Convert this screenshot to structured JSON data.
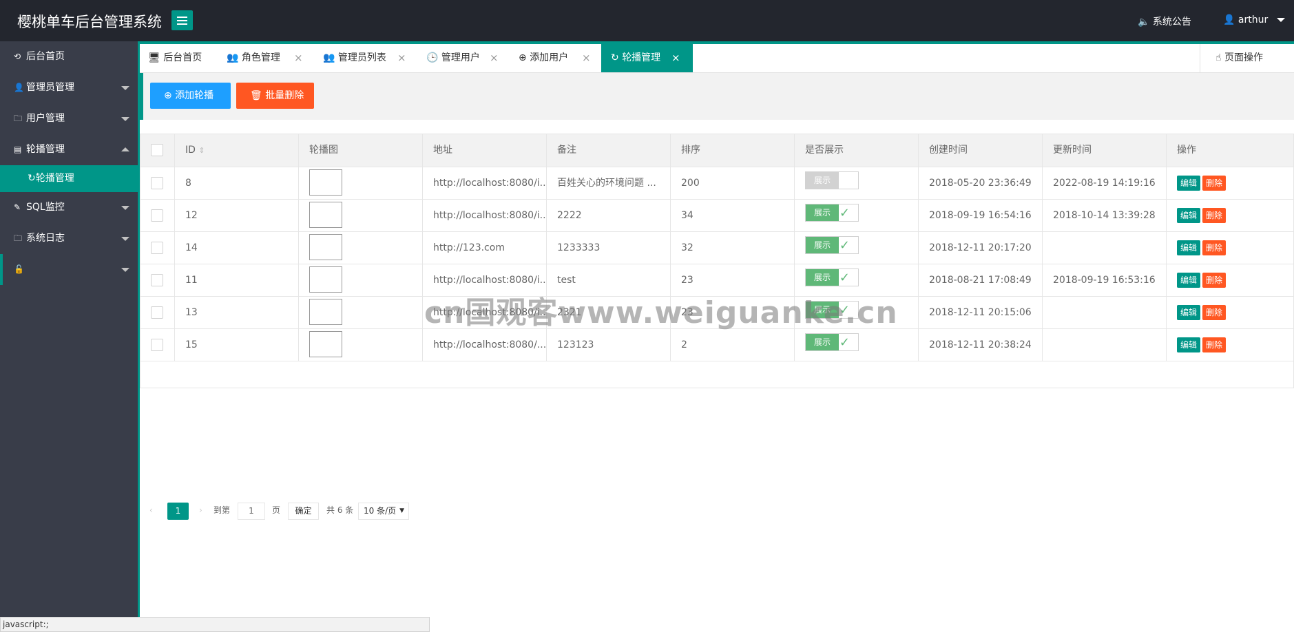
{
  "header": {
    "title": "樱桃单车后台管理系统",
    "notice": "系统公告",
    "user": "arthur"
  },
  "sidebar": {
    "items": [
      {
        "label": "后台首页",
        "icon": "home-icon"
      },
      {
        "label": "管理员管理",
        "icon": "user-icon"
      },
      {
        "label": "用户管理",
        "icon": "folder-icon"
      },
      {
        "label": "轮播管理",
        "icon": "image-icon"
      },
      {
        "label": "轮播管理",
        "icon": "refresh-icon"
      },
      {
        "label": "SQL监控",
        "icon": "edit-icon"
      },
      {
        "label": "系统日志",
        "icon": "folder-icon"
      }
    ]
  },
  "tabs": [
    {
      "label": "后台首页",
      "icon": "monitor-icon"
    },
    {
      "label": "角色管理",
      "icon": "users-icon"
    },
    {
      "label": "管理员列表",
      "icon": "users-icon"
    },
    {
      "label": "管理用户",
      "icon": "clock-icon"
    },
    {
      "label": "添加用户",
      "icon": "add-circle-icon"
    },
    {
      "label": "轮播管理",
      "icon": "refresh-icon"
    }
  ],
  "page_op": "页面操作",
  "toolbar": {
    "add": "添加轮播",
    "batch_delete": "批量删除"
  },
  "table": {
    "headers": [
      "ID",
      "轮播图",
      "地址",
      "备注",
      "排序",
      "是否展示",
      "创建时间",
      "更新时间",
      "操作"
    ],
    "rows": [
      {
        "id": "8",
        "url": "http://localhost:8080/i...",
        "remark": "百姓关心的环境问题 ...",
        "sort": "200",
        "show": false,
        "created": "2018-05-20 23:36:49",
        "updated": "2022-08-19 14:19:16"
      },
      {
        "id": "12",
        "url": "http://localhost:8080/i...",
        "remark": "2222",
        "sort": "34",
        "show": true,
        "created": "2018-09-19 16:54:16",
        "updated": "2018-10-14 13:39:28"
      },
      {
        "id": "14",
        "url": "http://123.com",
        "remark": "1233333",
        "sort": "32",
        "show": true,
        "created": "2018-12-11 20:17:20",
        "updated": ""
      },
      {
        "id": "11",
        "url": "http://localhost:8080/i...",
        "remark": "test",
        "sort": "23",
        "show": true,
        "created": "2018-08-21 17:08:49",
        "updated": "2018-09-19 16:53:16"
      },
      {
        "id": "13",
        "url": "http://localhost:8080/i...",
        "remark": "2321",
        "sort": "23",
        "show": true,
        "created": "2018-12-11 20:15:06",
        "updated": ""
      },
      {
        "id": "15",
        "url": "http://localhost:8080/...",
        "remark": "123123",
        "sort": "2",
        "show": true,
        "created": "2018-12-11 20:38:24",
        "updated": ""
      }
    ],
    "switch_label": "展示",
    "edit_label": "编辑",
    "delete_label": "删除"
  },
  "pager": {
    "current": "1",
    "goto": "到第",
    "page_input": "1",
    "page_unit": "页",
    "confirm": "确定",
    "total": "共 6 条",
    "per_page": "10 条/页"
  },
  "watermark": "cn国观客www.weiguanke.cn",
  "status_bar": "javascript:;",
  "colors": {
    "accent": "#009688",
    "header_bg": "#23262e",
    "sidebar_bg": "#393d49",
    "blue": "#1e9fff",
    "red": "#ff5722",
    "switch_on": "#5fb878"
  }
}
